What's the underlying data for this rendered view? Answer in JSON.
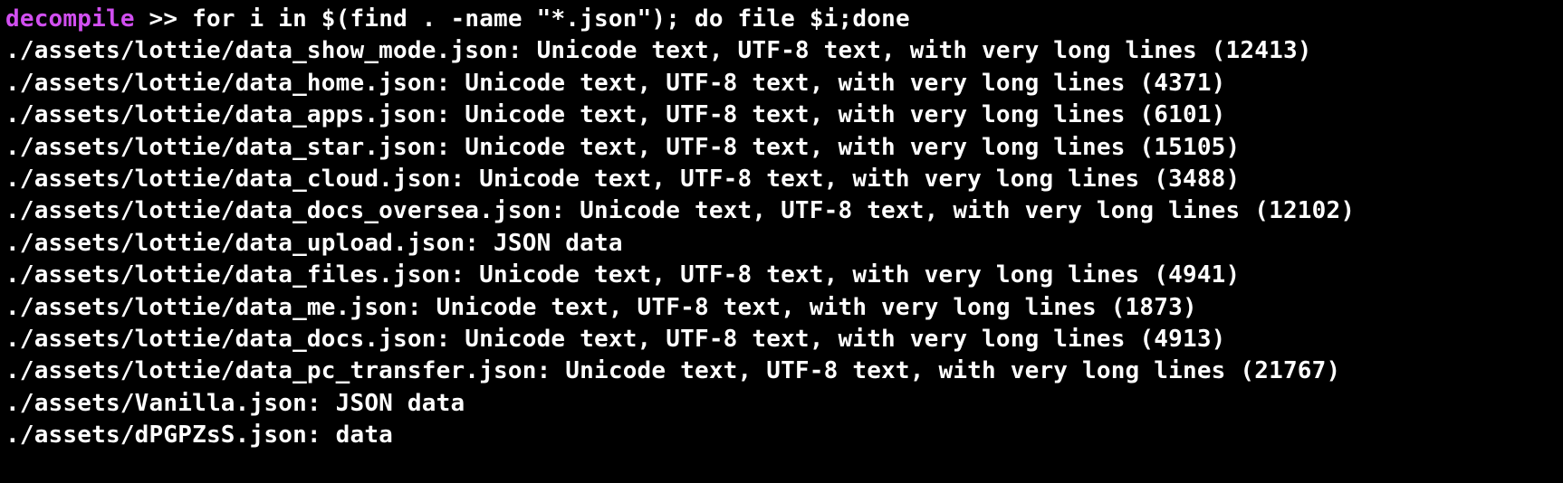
{
  "prompt": {
    "host": "decompile",
    "arrows": ">>",
    "command": "for i in $(find . -name \"*.json\"); do file $i;done"
  },
  "output": [
    "./assets/lottie/data_show_mode.json: Unicode text, UTF-8 text, with very long lines (12413)",
    "./assets/lottie/data_home.json: Unicode text, UTF-8 text, with very long lines (4371)",
    "./assets/lottie/data_apps.json: Unicode text, UTF-8 text, with very long lines (6101)",
    "./assets/lottie/data_star.json: Unicode text, UTF-8 text, with very long lines (15105)",
    "./assets/lottie/data_cloud.json: Unicode text, UTF-8 text, with very long lines (3488)",
    "./assets/lottie/data_docs_oversea.json: Unicode text, UTF-8 text, with very long lines (12102)",
    "./assets/lottie/data_upload.json: JSON data",
    "./assets/lottie/data_files.json: Unicode text, UTF-8 text, with very long lines (4941)",
    "./assets/lottie/data_me.json: Unicode text, UTF-8 text, with very long lines (1873)",
    "./assets/lottie/data_docs.json: Unicode text, UTF-8 text, with very long lines (4913)",
    "./assets/lottie/data_pc_transfer.json: Unicode text, UTF-8 text, with very long lines (21767)",
    "./assets/Vanilla.json: JSON data",
    "./assets/dPGPZsS.json: data"
  ]
}
